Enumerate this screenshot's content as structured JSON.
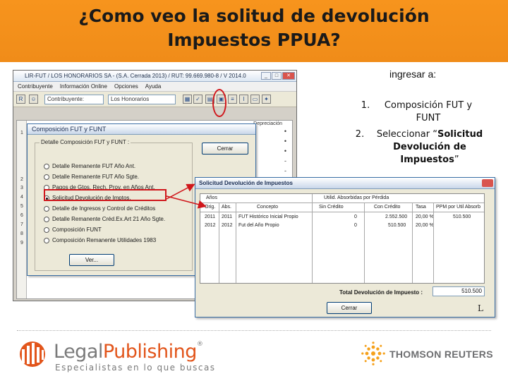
{
  "slide": {
    "title_line1": "¿Como veo la solitud de devolución",
    "title_line2": "Impuestos PPUA?",
    "instructions": {
      "heading": "ingresar a:",
      "step1_num": "1.",
      "step1": "Composición FUT y FUNT",
      "step2_num": "2.",
      "step2_prefix": "Seleccionar “",
      "step2_bold": "Solicitud Devolución de Impuestos",
      "step2_suffix": "”"
    }
  },
  "main_window": {
    "title": "LIR-FUT / LOS HONORARIOS SA - (S.A. Cerrada 2013) / RUT: 99.669.980-8 / V 2014.0",
    "menu": [
      "Contribuyente",
      "Información Online",
      "Opciones",
      "Ayuda"
    ],
    "toolbar": {
      "field1": "Contribuyente:",
      "field2": "Los Honorarios"
    },
    "grid_header": "Depreciación",
    "row_numbers": [
      "1",
      "2",
      "3",
      "4",
      "5",
      "6",
      "7",
      "8",
      "9"
    ]
  },
  "dialog_composicion": {
    "title": "Composición FUT y FUNT",
    "group_label": "Detalle Composición FUT y FUNT :",
    "options": [
      "Detalle Remanente FUT Año Ant.",
      "Detalle Remanente FUT Año Sgte.",
      "Pagos de Gtos. Rech. Prov. en Años Ant.",
      "Solicitud Devolución de Imptos.",
      "Detalle de Ingresos y Control de Créditos",
      "Detalle Remanente Créd.Ex.Art 21 Año Sgte.",
      "Composición FUNT",
      "Composición Remanente Utilidades 1983"
    ],
    "selected_index": 3,
    "btn_close": "Cerrar",
    "btn_view": "Ver..."
  },
  "dialog_solicitud": {
    "title": "Solicitud Devolución de Impuestos",
    "group_years": "Años",
    "group_util": "Utilid. Absorbidas por Pérdida",
    "columns": [
      "Orig.",
      "Abs.",
      "Concepto",
      "Sin Crédito",
      "Con Crédito",
      "Tasa",
      "PPM por Util Absorb"
    ],
    "rows": [
      [
        "2011",
        "2011",
        "FUT Histórico Inicial Propio",
        "0",
        "2.552.500",
        "20,00 %",
        "510.500"
      ],
      [
        "2012",
        "2012",
        "Fut del Año Propio",
        "0",
        "510.500",
        "20,00 %",
        ""
      ]
    ],
    "total_label": "Total Devolución de Impuesto :",
    "total_value": "510.500",
    "btn_close": "Cerrar",
    "corner_mark": "L"
  },
  "footer": {
    "legal_word1": "Legal",
    "legal_word2": "Publishing",
    "legal_reg": "®",
    "legal_tagline": "Especialistas en lo que buscas",
    "tr_name": "THOMSON REUTERS"
  },
  "colors": {
    "banner": "#f7941d",
    "highlight": "#d0161b",
    "legal_orange": "#e2551b",
    "tr_orange": "#f5a11c"
  }
}
